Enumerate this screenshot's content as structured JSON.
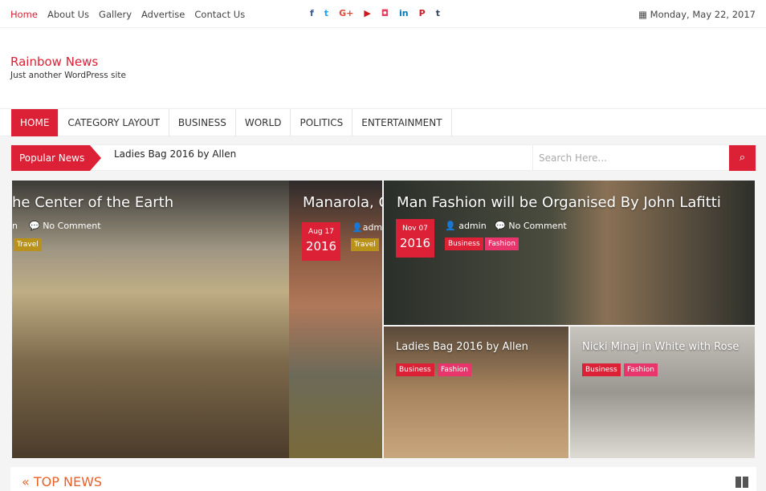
{
  "topbar": {
    "menu": [
      "Home",
      "About Us",
      "Gallery",
      "Advertise",
      "Contact Us"
    ],
    "social": [
      {
        "icon": "facebook-icon",
        "glyph": "f",
        "color": "#3b5998"
      },
      {
        "icon": "twitter-icon",
        "glyph": "t",
        "color": "#1da1f2"
      },
      {
        "icon": "google-plus-icon",
        "glyph": "G+",
        "color": "#dd4b39"
      },
      {
        "icon": "youtube-icon",
        "glyph": "▶",
        "color": "#cc181e"
      },
      {
        "icon": "instagram-icon",
        "glyph": "◘",
        "color": "#e4405f"
      },
      {
        "icon": "linkedin-icon",
        "glyph": "in",
        "color": "#0077b5"
      },
      {
        "icon": "pinterest-icon",
        "glyph": "P",
        "color": "#cb2027"
      },
      {
        "icon": "tumblr-icon",
        "glyph": "t",
        "color": "#35465c"
      }
    ],
    "date": "Monday, May 22, 2017"
  },
  "header": {
    "title": "Rainbow News",
    "tagline": "Just another WordPress site"
  },
  "nav": [
    "HOME",
    "CATEGORY LAYOUT",
    "BUSINESS",
    "WORLD",
    "POLITICS",
    "ENTERTAINMENT"
  ],
  "ticker": {
    "label": "Popular News",
    "text": "Ladies Bag 2016 by Allen",
    "search_placeholder": "Search Here..."
  },
  "tiles": [
    {
      "title": "he Center of the Earth",
      "author": "n",
      "comments": "No Comment",
      "tags": [
        "Travel"
      ]
    },
    {
      "title": "Manarola, C",
      "date_md": "Aug 17",
      "date_y": "2016",
      "author": "admi",
      "tags": [
        "Travel"
      ]
    },
    {
      "title": "Man Fashion will be Organised By John Lafitti",
      "date_md": "Nov 07",
      "date_y": "2016",
      "author": "admin",
      "comments": "No Comment",
      "tags": [
        "Business",
        "Fashion"
      ]
    },
    {
      "title": "Ladies Bag 2016 by Allen",
      "tags": [
        "Business",
        "Fashion"
      ]
    },
    {
      "title": "Nicki Minaj in White with Rose",
      "tags": [
        "Business",
        "Fashion"
      ]
    }
  ],
  "topnews": {
    "title": "TOP NEWS"
  },
  "colors": {
    "accent": "#dc2035",
    "travel": "#b8921b",
    "fashion": "#e8356b"
  }
}
